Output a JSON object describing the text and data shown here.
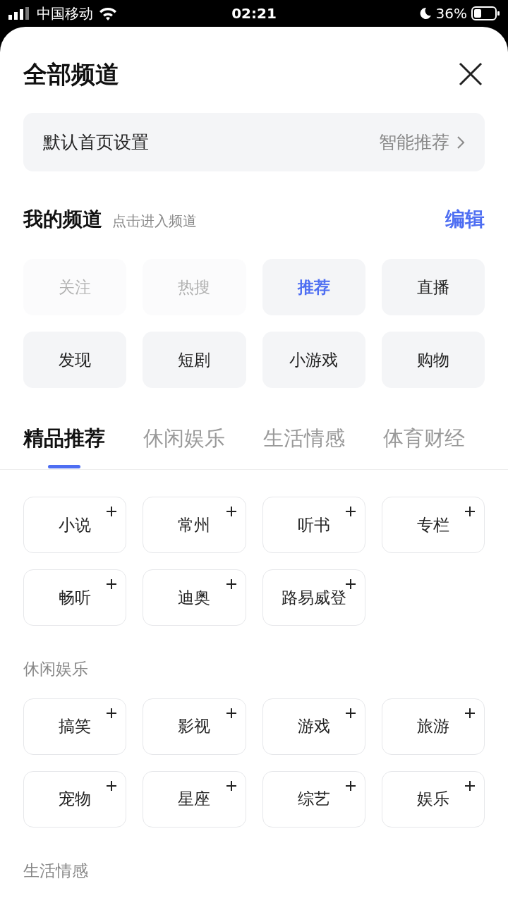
{
  "status_bar": {
    "carrier": "中国移动",
    "time": "02:21",
    "battery": "36%"
  },
  "title": "全部频道",
  "default_home": {
    "label": "默认首页设置",
    "value": "智能推荐"
  },
  "my_channels": {
    "title": "我的频道",
    "hint": "点击进入频道",
    "edit": "编辑",
    "items": [
      {
        "label": "关注",
        "disabled": true,
        "selected": false
      },
      {
        "label": "热搜",
        "disabled": true,
        "selected": false
      },
      {
        "label": "推荐",
        "disabled": false,
        "selected": true
      },
      {
        "label": "直播",
        "disabled": false,
        "selected": false
      },
      {
        "label": "发现",
        "disabled": false,
        "selected": false
      },
      {
        "label": "短剧",
        "disabled": false,
        "selected": false
      },
      {
        "label": "小游戏",
        "disabled": false,
        "selected": false
      },
      {
        "label": "购物",
        "disabled": false,
        "selected": false
      }
    ]
  },
  "category_tabs": [
    {
      "label": "精品推荐",
      "selected": true
    },
    {
      "label": "休闲娱乐",
      "selected": false
    },
    {
      "label": "生活情感",
      "selected": false
    },
    {
      "label": "体育财经",
      "selected": false
    }
  ],
  "sections": [
    {
      "items": [
        "小说",
        "常州",
        "听书",
        "专栏",
        "畅听",
        "迪奥",
        "路易威登"
      ]
    },
    {
      "heading": "休闲娱乐",
      "items": [
        "搞笑",
        "影视",
        "游戏",
        "旅游",
        "宠物",
        "星座",
        "综艺",
        "娱乐"
      ]
    },
    {
      "heading": "生活情感"
    }
  ]
}
